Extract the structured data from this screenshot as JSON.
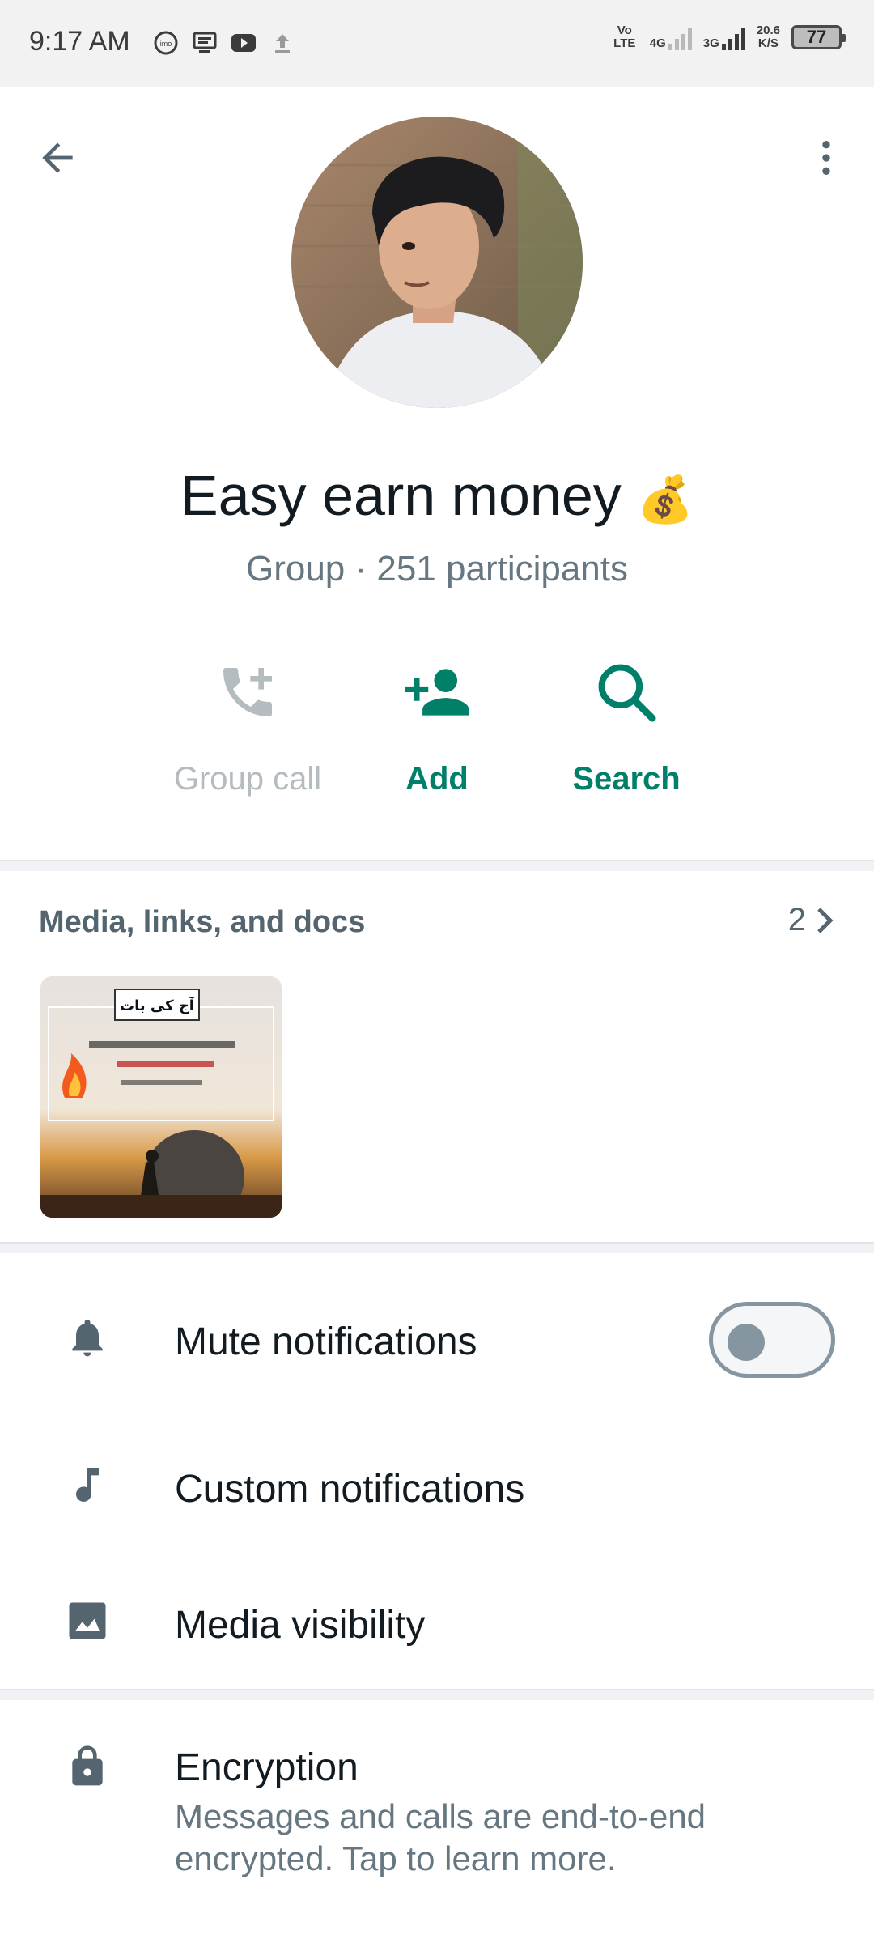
{
  "status_bar": {
    "time": "9:17 AM",
    "notifications": [
      "imo-icon",
      "message-icon",
      "youtube-icon",
      "upload-icon"
    ],
    "volte": "Vo LTE",
    "net1": "4G",
    "net2": "3G",
    "speed_value": "20.6",
    "speed_unit": "K/S",
    "battery": "77"
  },
  "toolbar": {
    "back_icon": "arrow-back-icon",
    "menu_icon": "more-vert-icon"
  },
  "group": {
    "name": "Easy earn money",
    "name_emoji": "💰",
    "subtitle": "Group · 251 participants"
  },
  "actions": [
    {
      "label": "Group call",
      "icon": "add-call-icon",
      "enabled": false
    },
    {
      "label": "Add",
      "icon": "person-add-icon",
      "enabled": true
    },
    {
      "label": "Search",
      "icon": "search-icon",
      "enabled": true
    }
  ],
  "media": {
    "title": "Media, links, and docs",
    "count": "2",
    "thumb_heading": "آج کی بات"
  },
  "settings": [
    {
      "label": "Mute notifications",
      "icon": "bell-icon",
      "toggle_on": false
    },
    {
      "label": "Custom notifications",
      "icon": "music-note-icon"
    },
    {
      "label": "Media visibility",
      "icon": "image-icon"
    }
  ],
  "encryption": {
    "title": "Encryption",
    "subtitle": "Messages and calls are end-to-end encrypted. Tap to learn more.",
    "icon": "lock-icon"
  },
  "colors": {
    "accent": "#008069",
    "secondary_text": "#667781",
    "disabled": "#b4bcc0"
  }
}
